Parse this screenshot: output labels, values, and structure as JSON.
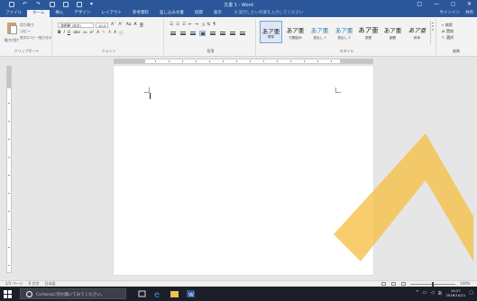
{
  "window": {
    "title": "文書 1 - Word",
    "controls": [
      "□",
      "—",
      "◻",
      "✕"
    ]
  },
  "tabs": {
    "items": [
      "ファイル",
      "ホーム",
      "挿入",
      "デザイン",
      "レイアウト",
      "参考資料",
      "差し込み文書",
      "校閲",
      "表示"
    ],
    "active": "ホーム",
    "tell_me": "♀ 実行したい作業を入力してください",
    "right": [
      "サインイン",
      "共有"
    ]
  },
  "ribbon": {
    "clipboard": {
      "paste": "貼り付け",
      "cut": "切り取り",
      "copy": "コピー",
      "format_painter": "書式のコピー/貼り付け",
      "label": "クリップボード"
    },
    "font": {
      "name": "游明朝 (本文)",
      "size": "10.5",
      "label": "フォント"
    },
    "paragraph": {
      "label": "段落"
    },
    "styles": {
      "label": "スタイル",
      "items": [
        {
          "sample": "あア亜",
          "name": "標準"
        },
        {
          "sample": "あア亜",
          "name": "行間詰め"
        },
        {
          "sample": "あア亜",
          "name": "見出し 1"
        },
        {
          "sample": "あア亜",
          "name": "見出し 2"
        },
        {
          "sample": "あア亜",
          "name": "表題"
        },
        {
          "sample": "あア亜",
          "name": "副題"
        },
        {
          "sample": "あア亜",
          "name": "斜体"
        }
      ]
    },
    "editing": {
      "find": "検索",
      "replace": "置換",
      "select": "選択",
      "label": "編集"
    }
  },
  "statusbar": {
    "page": "1/1 ページ",
    "words": "0 文字",
    "language": "日本語",
    "zoom": "100%",
    "zoom_level": 0.5
  },
  "taskbar": {
    "cortana_placeholder": "Cortanaに何か聞いてみてください。",
    "time": "14:27",
    "date": "2016/10/21",
    "ime": "あ"
  },
  "colors": {
    "word_blue": "#2b579a",
    "overlay": "#f5c04a"
  }
}
